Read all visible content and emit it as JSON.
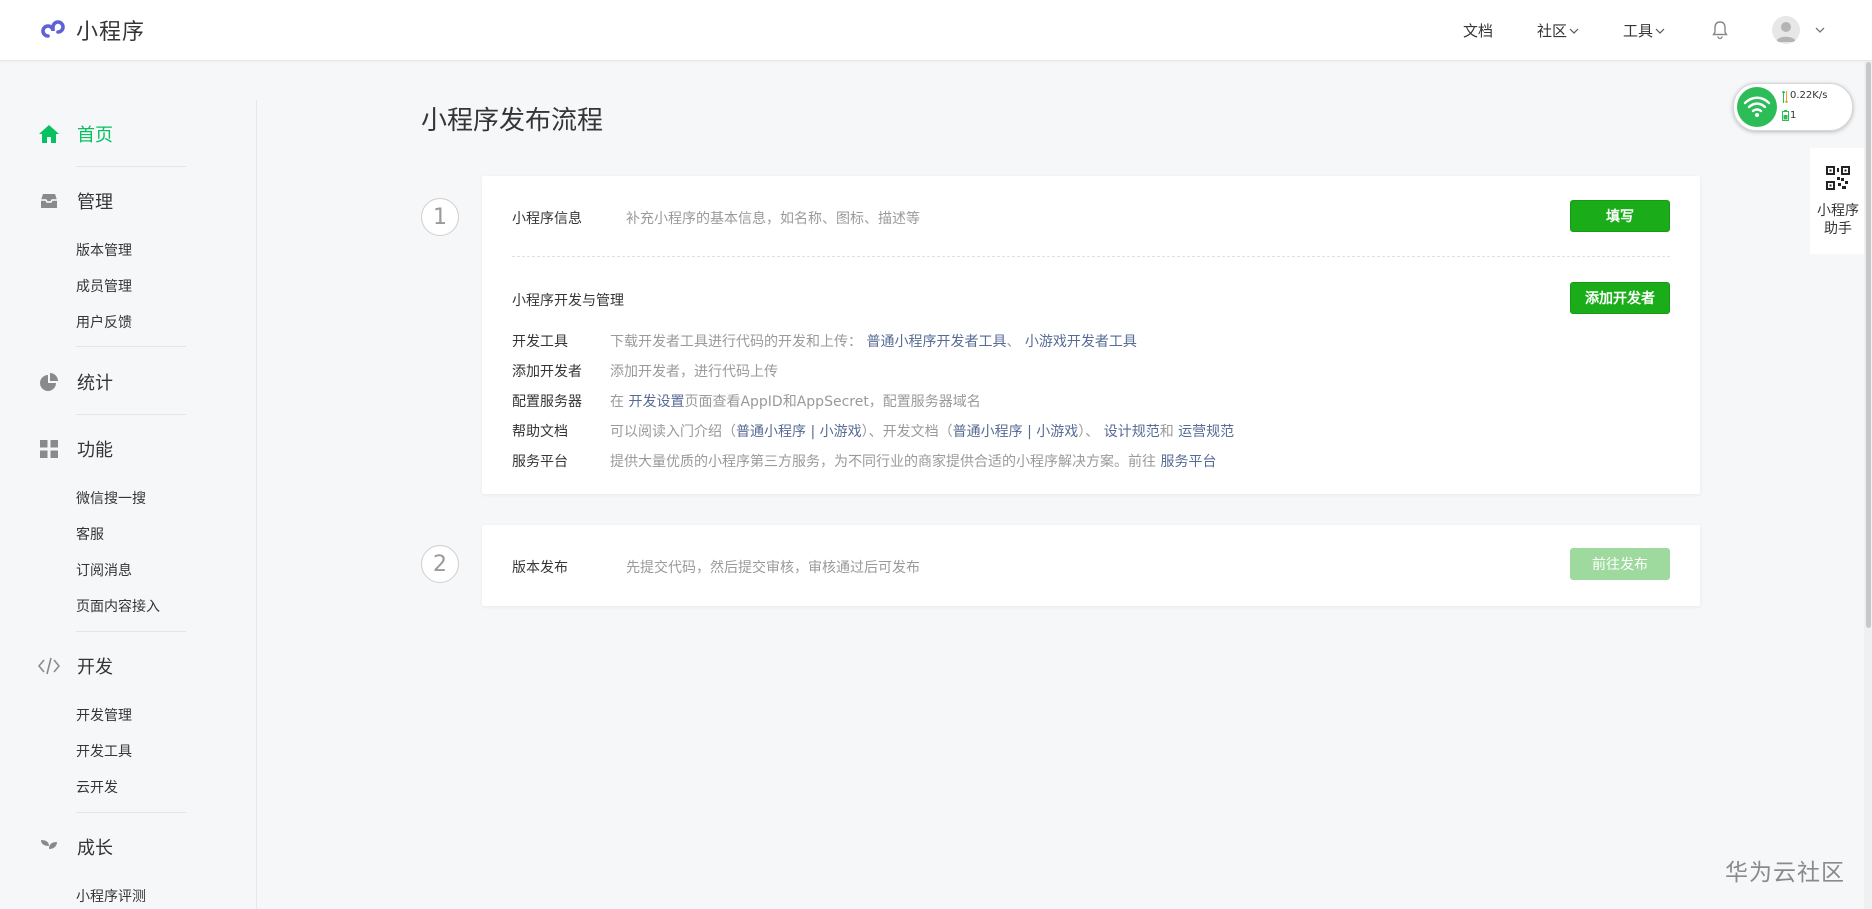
{
  "app": {
    "name": "小程序"
  },
  "topnav": {
    "docs": "文档",
    "community": "社区",
    "tools": "工具"
  },
  "sidebar": {
    "home": "首页",
    "manage": {
      "label": "管理",
      "items": [
        "版本管理",
        "成员管理",
        "用户反馈"
      ]
    },
    "stats": {
      "label": "统计"
    },
    "features": {
      "label": "功能",
      "items": [
        "微信搜一搜",
        "客服",
        "订阅消息",
        "页面内容接入"
      ]
    },
    "dev": {
      "label": "开发",
      "items": [
        "开发管理",
        "开发工具",
        "云开发"
      ]
    },
    "growth": {
      "label": "成长",
      "items": [
        "小程序评测"
      ]
    }
  },
  "main": {
    "title": "小程序发布流程",
    "step1": {
      "number": "1",
      "info": {
        "label": "小程序信息",
        "desc": "补充小程序的基本信息，如名称、图标、描述等",
        "button": "填写"
      },
      "devmgmt": {
        "label": "小程序开发与管理",
        "button": "添加开发者"
      },
      "rows": {
        "devtools": {
          "label": "开发工具",
          "text": "下载开发者工具进行代码的开发和上传：",
          "link1": "普通小程序开发者工具",
          "sep": "、",
          "link2": "小游戏开发者工具"
        },
        "adddev": {
          "label": "添加开发者",
          "text": "添加开发者，进行代码上传"
        },
        "server": {
          "label": "配置服务器",
          "pre": "在",
          "link": "开发设置",
          "post": "页面查看AppID和AppSecret，配置服务器域名"
        },
        "help": {
          "label": "帮助文档",
          "t1": "可以阅读入门介绍（",
          "l1": "普通小程序",
          "bar1": "|",
          "l2": "小游戏",
          "t2": "）、开发文档（",
          "l3": "普通小程序",
          "bar2": "|",
          "l4": "小游戏",
          "t3": "）、",
          "l5": "设计规范",
          "t4": "和",
          "l6": "运营规范"
        },
        "platform": {
          "label": "服务平台",
          "text": "提供大量优质的小程序第三方服务，为不同行业的商家提供合适的小程序解决方案。前往",
          "link": "服务平台"
        }
      }
    },
    "step2": {
      "number": "2",
      "label": "版本发布",
      "desc": "先提交代码，然后提交审核，审核通过后可发布",
      "button": "前往发布"
    }
  },
  "widgets": {
    "net_speed": "0.22K/s",
    "net_count": "1",
    "assistant": [
      "小程序",
      "助手"
    ]
  },
  "watermark": "华为云社区",
  "colors": {
    "accent": "#07c160",
    "button": "#1aad19",
    "link": "#576b95"
  }
}
